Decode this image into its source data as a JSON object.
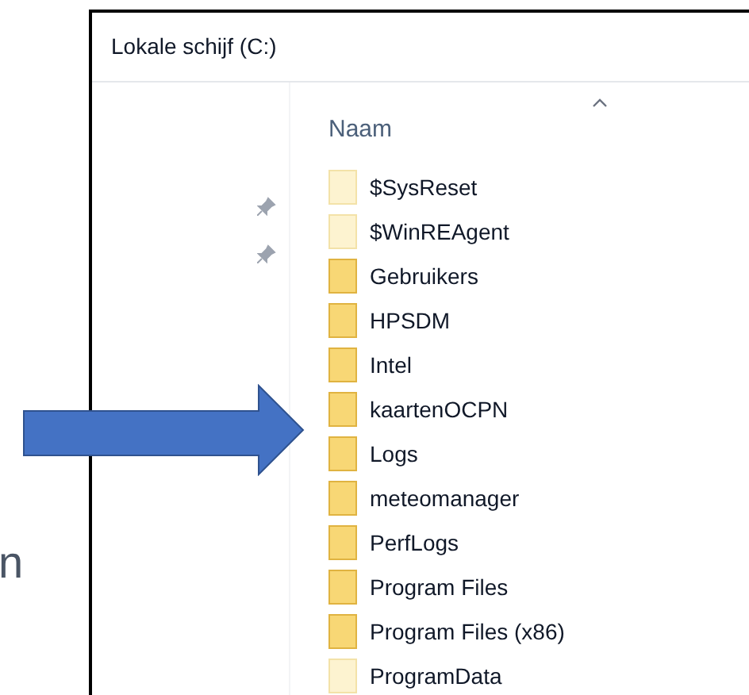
{
  "window": {
    "title": "Lokale schijf (C:)"
  },
  "column_header": {
    "label": "Naam"
  },
  "folders": [
    {
      "name": "$SysReset",
      "hidden": true
    },
    {
      "name": "$WinREAgent",
      "hidden": true
    },
    {
      "name": "Gebruikers",
      "hidden": false
    },
    {
      "name": "HPSDM",
      "hidden": false
    },
    {
      "name": "Intel",
      "hidden": false
    },
    {
      "name": "kaartenOCPN",
      "hidden": false
    },
    {
      "name": "Logs",
      "hidden": false
    },
    {
      "name": "meteomanager",
      "hidden": false
    },
    {
      "name": "PerfLogs",
      "hidden": false
    },
    {
      "name": "Program Files",
      "hidden": false
    },
    {
      "name": "Program Files (x86)",
      "hidden": false
    },
    {
      "name": "ProgramData",
      "hidden": true
    }
  ],
  "side_text": "n"
}
